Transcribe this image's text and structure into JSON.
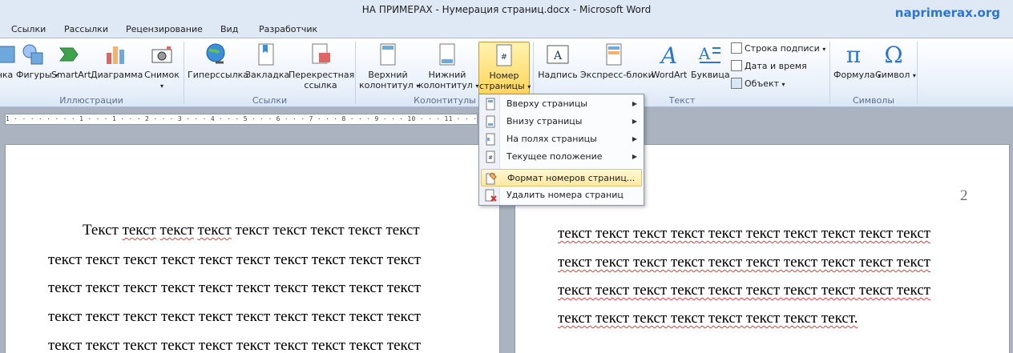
{
  "window": {
    "title": "НА ПРИМЕРАХ - Нумерация страниц.docx  -  Microsoft Word",
    "brand": "naprimerax.org"
  },
  "tabs": [
    "Ссылки",
    "Рассылки",
    "Рецензирование",
    "Вид",
    "Разработчик"
  ],
  "ribbon": {
    "illustrations": {
      "label": "Иллюстрации",
      "buttons": [
        "нка",
        "Фигуры",
        "SmartArt",
        "Диаграмма",
        "Снимок"
      ]
    },
    "links": {
      "label": "Ссылки",
      "buttons": [
        "Гиперссылка",
        "Закладка",
        "Перекрестная",
        "ссылка"
      ]
    },
    "headers": {
      "label": "Колонтитулы",
      "header_l1": "Верхний",
      "header_l2": "колонтитул",
      "footer_l1": "Нижний",
      "footer_l2": "колонтитул",
      "pagenum_l1": "Номер",
      "pagenum_l2": "страницы"
    },
    "text": {
      "label": "Текст",
      "buttons": [
        "Надпись",
        "Экспресс-блоки",
        "WordArt",
        "Буквица"
      ],
      "small": [
        "Строка подписи",
        "Дата и время",
        "Объект"
      ]
    },
    "symbols": {
      "label": "Символы",
      "buttons": [
        "Формула",
        "Символ"
      ]
    }
  },
  "ruler": {
    "text": "1 · · · · · · · · 1 · · · 1 · · · 2 · · · 3 · · · 4 · · · 5 · · · 6 · · · 7 · · · 8 · · · 9 · · · 10 · · · 11 · · · 12 · · · 13"
  },
  "menu": {
    "items": [
      "Вверху страницы",
      "Внизу страницы",
      "На полях страницы",
      "Текущее положение",
      "Формат номеров страниц...",
      "Удалить номера страниц"
    ]
  },
  "document": {
    "left_page": {
      "lines": [
        [
          "Текст ",
          "текст",
          " ",
          "текст",
          " ",
          "текст",
          " текст текст текст текст текст"
        ],
        [
          "текст текст текст текст текст текст текст текст текст текст"
        ],
        [
          "текст текст текст текст текст текст текст текст текст текст"
        ],
        [
          "текст текст текст текст текст текст текст текст текст текст"
        ],
        [
          "текст текст текст текст текст текст текст текст текст текст"
        ]
      ]
    },
    "right_page": {
      "page_number": "2",
      "lines": [
        "текст текст текст текст текст текст текст текст текст текст",
        "текст текст текст текст текст текст текст текст текст текст",
        "текст текст текст текст текст текст текст текст текст текст",
        "текст текст текст текст текст текст текст текст."
      ]
    }
  },
  "colors": {
    "ribbon_bg": "#dfe9f5",
    "active_button": "#ffd65a",
    "brand": "#2e75d0",
    "spelling_underline": "#e23b3b"
  }
}
